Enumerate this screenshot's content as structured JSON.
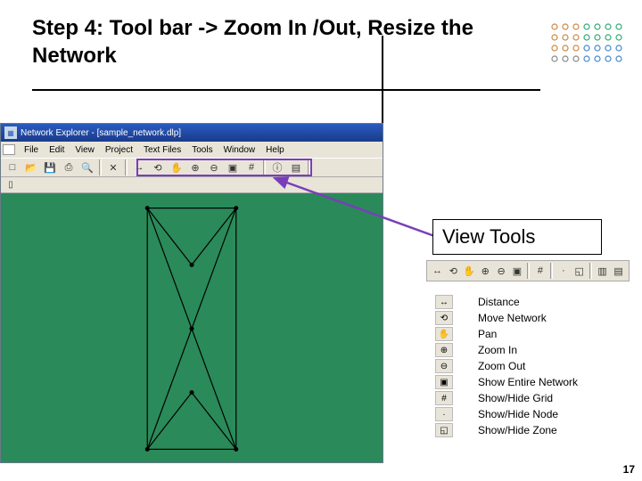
{
  "slide": {
    "title": "Step 4: Tool bar -> Zoom In /Out, Resize the Network",
    "page_number": "17"
  },
  "app": {
    "title": "Network Explorer - [sample_network.dlp]"
  },
  "menu": {
    "file": "File",
    "edit": "Edit",
    "view": "View",
    "project": "Project",
    "textfiles": "Text Files",
    "tools": "Tools",
    "window": "Window",
    "help": "Help"
  },
  "view_tools": {
    "header": "View Tools",
    "items": [
      {
        "icon": "↔",
        "label": "Distance"
      },
      {
        "icon": "⟲",
        "label": "Move Network"
      },
      {
        "icon": "✋",
        "label": "Pan"
      },
      {
        "icon": "⊕",
        "label": "Zoom In"
      },
      {
        "icon": "⊖",
        "label": "Zoom Out"
      },
      {
        "icon": "▣",
        "label": "Show Entire Network"
      },
      {
        "icon": "#",
        "label": "Show/Hide Grid"
      },
      {
        "icon": "·",
        "label": "Show/Hide Node"
      },
      {
        "icon": "◱",
        "label": "Show/Hide Zone"
      }
    ]
  },
  "toolbar_icons": {
    "new": "□",
    "open": "📂",
    "save": "💾",
    "print": "⎙",
    "preview": "🔍",
    "delete": "✕",
    "distance": "↔",
    "move": "⟲",
    "pan": "✋",
    "zoomin": "⊕",
    "zoomout": "⊖",
    "fit": "▣",
    "grid": "#",
    "node": "·",
    "zone": "◱",
    "info": "ⓘ",
    "layers": "▤"
  }
}
